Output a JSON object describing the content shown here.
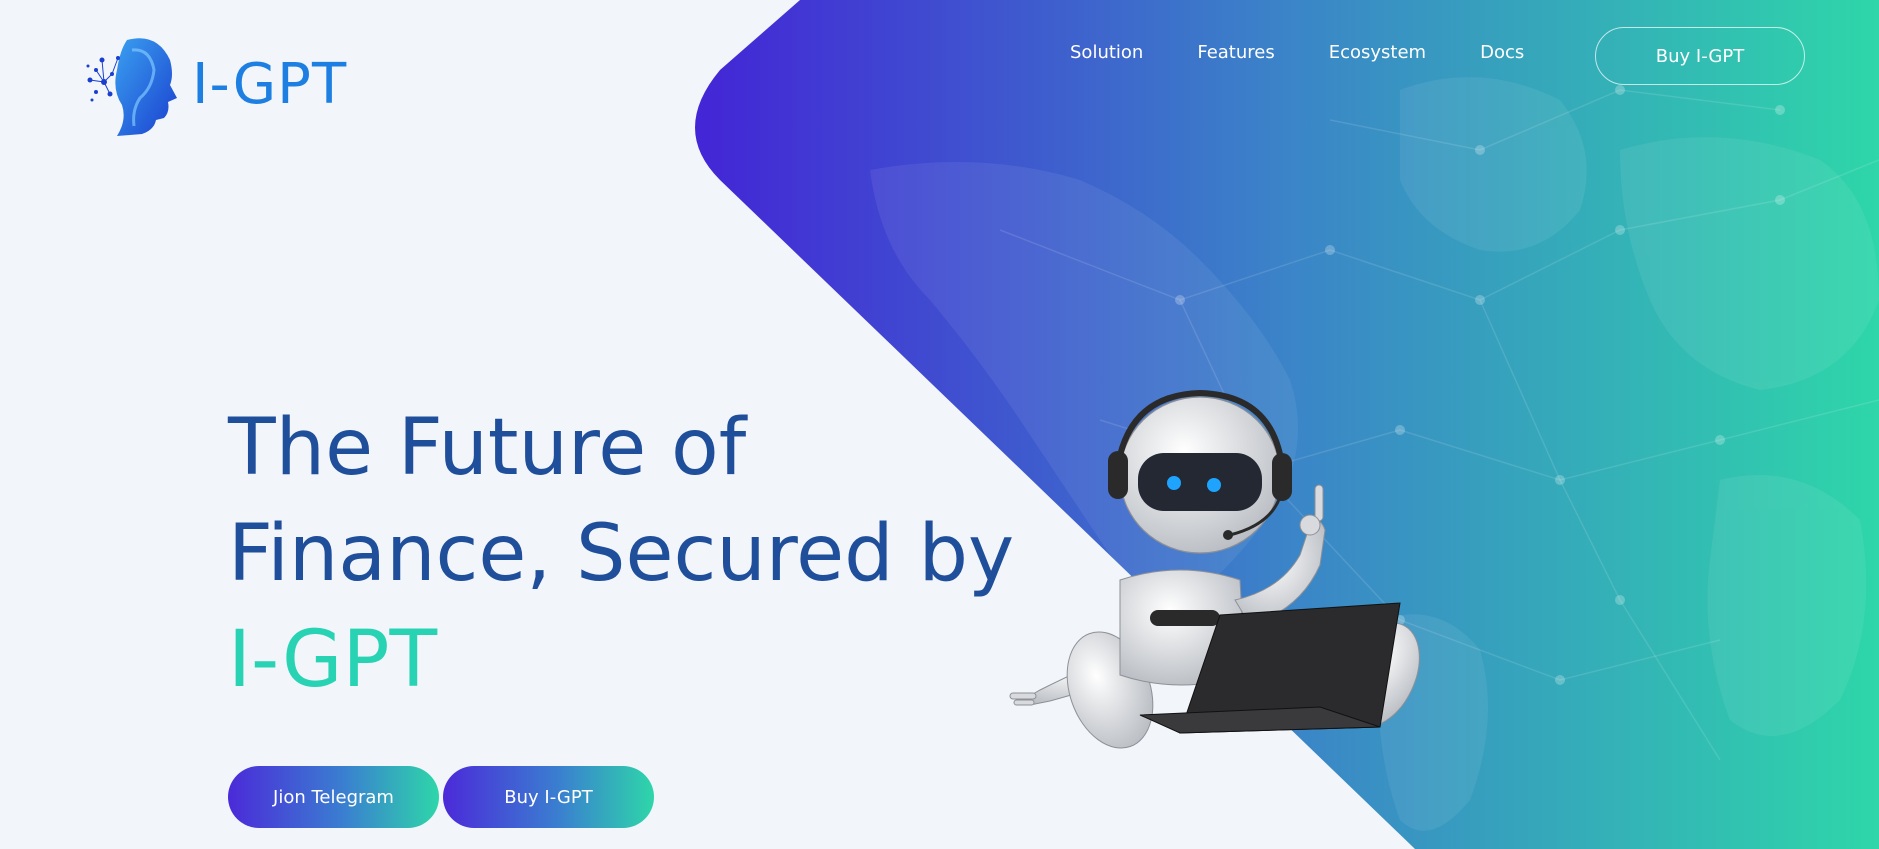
{
  "brand": {
    "name": "I-GPT",
    "logo_icon": "ai-head-icon",
    "primary_color": "#1e7fe3",
    "accent_color": "#28d3b4"
  },
  "nav": {
    "items": [
      {
        "label": "Solution"
      },
      {
        "label": "Features"
      },
      {
        "label": "Ecosystem"
      },
      {
        "label": "Docs"
      }
    ],
    "buy_button": "Buy I-GPT"
  },
  "hero": {
    "line1": "The Future of",
    "line2": "Finance, Secured by",
    "line3": "I-GPT",
    "headline_color": "#1f4e9a",
    "gradient_start": "#4325d6",
    "gradient_end": "#2ed6a9",
    "illustration": "robot-with-laptop-icon"
  },
  "cta": {
    "telegram": "Jion Telegram",
    "buy": "Buy I-GPT"
  }
}
